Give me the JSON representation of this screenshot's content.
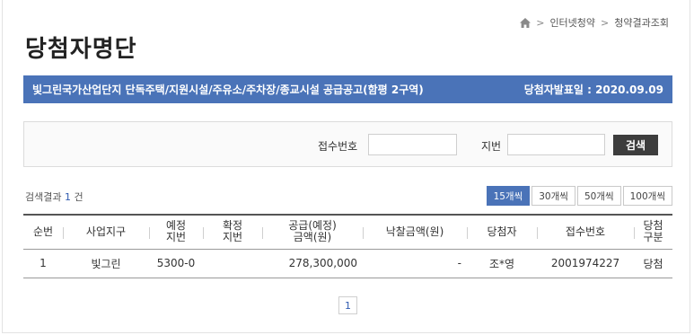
{
  "breadcrumb": {
    "items": [
      "인터넷청약",
      "청약결과조회"
    ],
    "separator": ">"
  },
  "page": {
    "title": "당첨자명단"
  },
  "notice": {
    "title": "빛그린국가산업단지 단독주택/지원시설/주유소/주차장/종교시설 공급공고(함평 2구역)",
    "announce_label": "당첨자발표일 : 2020.09.09"
  },
  "search": {
    "receipt_label": "접수번호",
    "receipt_value": "",
    "lot_label": "지번",
    "lot_value": "",
    "button_label": "검색"
  },
  "results": {
    "prefix": "검색결과",
    "count": "1",
    "suffix": "건"
  },
  "per_page": {
    "options": [
      "15개씩",
      "30개씩",
      "50개씩",
      "100개씩"
    ],
    "selected": "15개씩"
  },
  "table": {
    "headers": {
      "no": "순번",
      "district": "사업지구",
      "planned_lot_1": "예정",
      "planned_lot_2": "지번",
      "confirmed_lot_1": "확정",
      "confirmed_lot_2": "지번",
      "supply_amount_1": "공급(예정)",
      "supply_amount_2": "금액(원)",
      "bid_amount": "낙찰금액(원)",
      "winner": "당첨자",
      "receipt_no": "접수번호",
      "category_1": "당첨",
      "category_2": "구분"
    },
    "rows": [
      {
        "no": "1",
        "district": "빛그린",
        "planned_lot": "5300-0",
        "confirmed_lot": "",
        "supply_amount": "278,300,000",
        "bid_amount": "-",
        "winner": "조*영",
        "receipt_no": "2001974227",
        "category": "당첨"
      }
    ]
  },
  "pagination": {
    "current": "1"
  },
  "colors": {
    "accent": "#4a73b8",
    "button_dark": "#3d3d3d",
    "link": "#2f5bb0"
  }
}
